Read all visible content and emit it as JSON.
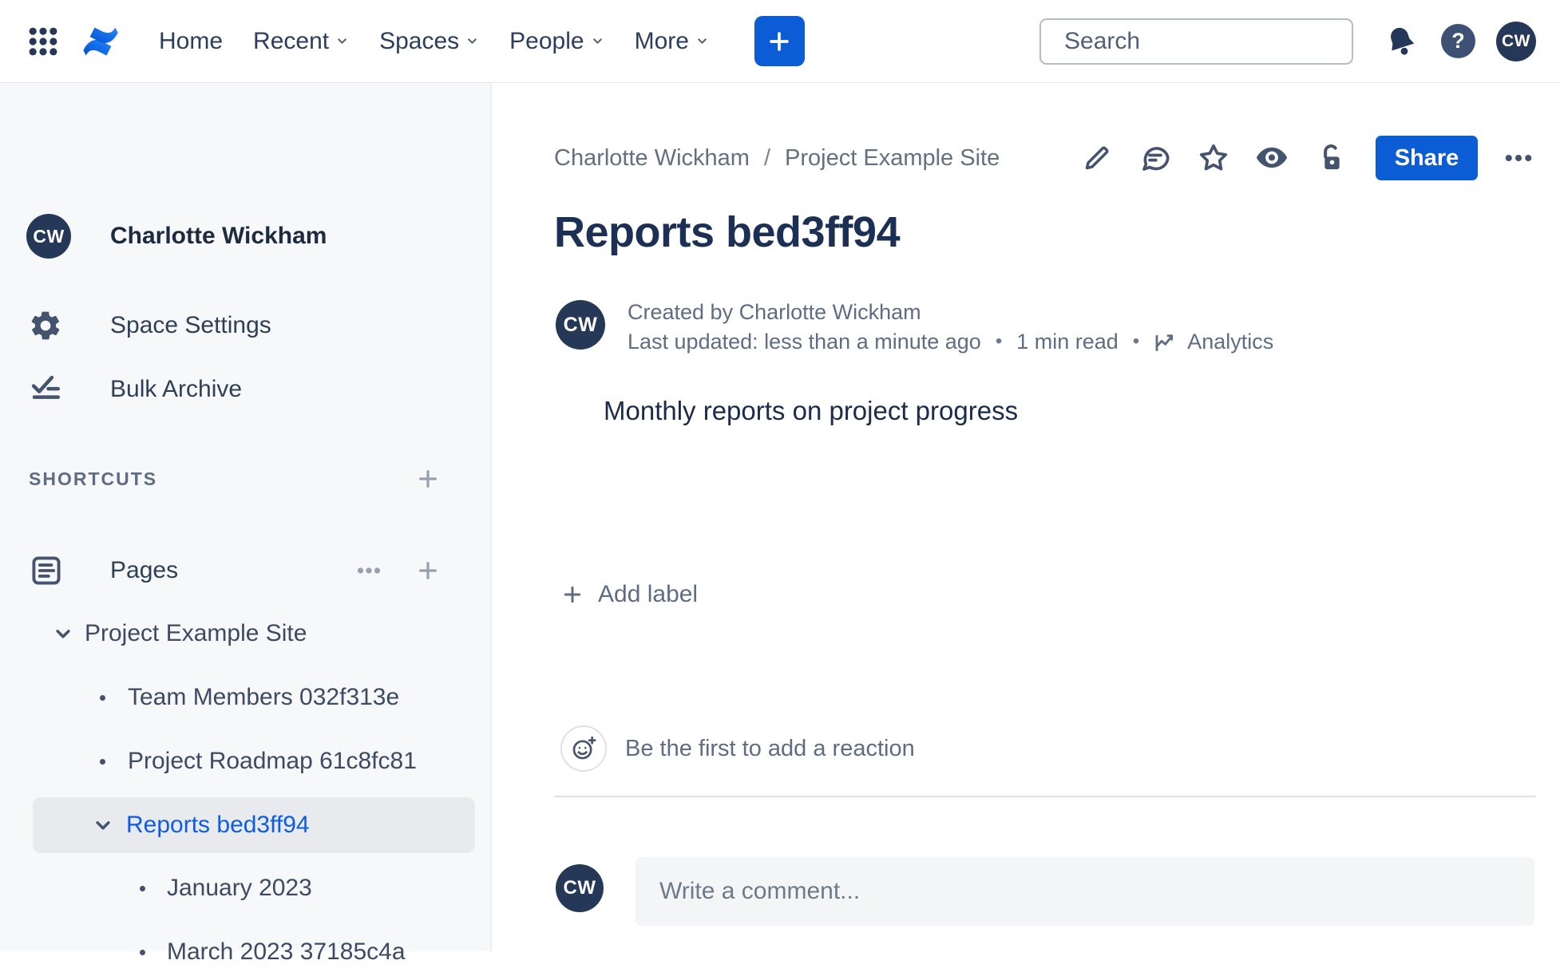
{
  "topbar": {
    "nav": {
      "home": "Home",
      "recent": "Recent",
      "spaces": "Spaces",
      "people": "People",
      "more": "More"
    },
    "search_placeholder": "Search",
    "help_glyph": "?",
    "avatar_initials": "CW"
  },
  "sidebar": {
    "space_avatar_initials": "CW",
    "space_name": "Charlotte Wickham",
    "space_settings_label": "Space Settings",
    "bulk_archive_label": "Bulk Archive",
    "shortcuts_label": "SHORTCUTS",
    "pages_label": "Pages",
    "tree": [
      {
        "label": "Project Example Site"
      },
      {
        "label": "Team Members 032f313e"
      },
      {
        "label": "Project Roadmap 61c8fc81"
      },
      {
        "label": "Reports bed3ff94"
      },
      {
        "label": "January 2023"
      },
      {
        "label": "March 2023 37185c4a"
      }
    ]
  },
  "content": {
    "breadcrumb": {
      "space": "Charlotte Wickham",
      "separator": "/",
      "parent": "Project Example Site"
    },
    "share_label": "Share",
    "title": "Reports bed3ff94",
    "author_avatar_initials": "CW",
    "created_by": "Created by Charlotte Wickham",
    "last_updated": "Last updated: less than a minute ago",
    "meta_separator": "•",
    "read_time": "1 min read",
    "analytics_label": "Analytics",
    "body_text": "Monthly reports on project progress",
    "add_label_text": "Add label",
    "reaction_prompt": "Be the first to add a reaction",
    "comment_placeholder": "Write a comment...",
    "commenter_avatar_initials": "CW"
  },
  "colors": {
    "brand_blue": "#0B5CD5",
    "selected_link_blue": "#0C5CE8",
    "navy": "#253858",
    "sidebar_bg": "#F7F8F9",
    "selected_row_bg": "#E8EAEE"
  }
}
